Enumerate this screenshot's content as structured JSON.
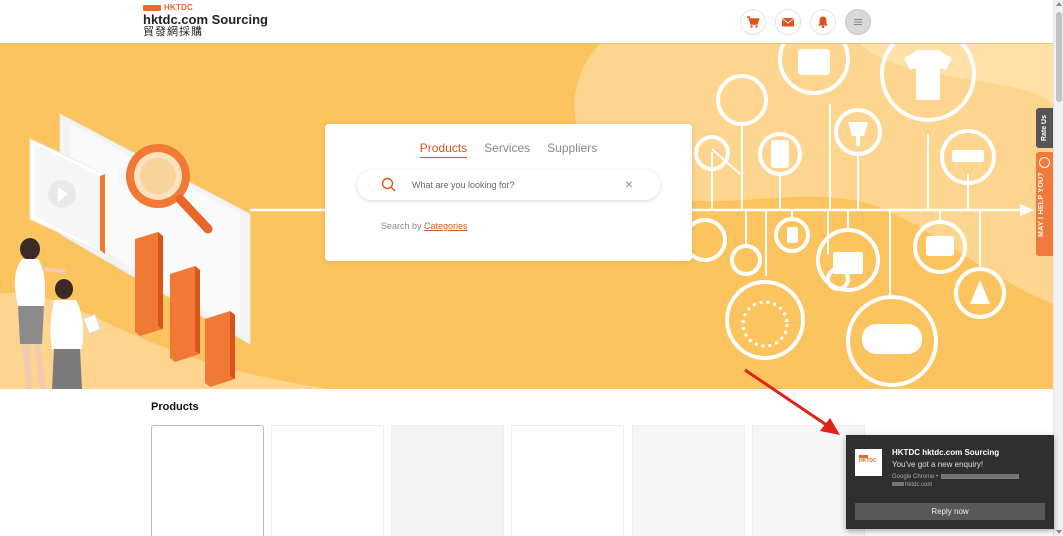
{
  "header": {
    "logo_small": "HKTDC",
    "logo_name": "hktdc.com Sourcing",
    "logo_chinese": "貿發網採購",
    "icons": [
      "cart-icon",
      "mail-icon",
      "bell-icon",
      "menu-icon"
    ]
  },
  "search": {
    "tabs": [
      {
        "label": "Products",
        "active": true
      },
      {
        "label": "Services",
        "active": false
      },
      {
        "label": "Suppliers",
        "active": false
      }
    ],
    "placeholder": "What are you looking for?",
    "clear_symbol": "×",
    "by_prefix": "Search by ",
    "by_link": "Categories"
  },
  "side": {
    "rate_us": "Rate Us",
    "help": "MAY I HELP YOU?"
  },
  "products": {
    "title": "Products"
  },
  "notification": {
    "title": "HKTDC hktdc.com Sourcing",
    "message": "You've got a new enquiry!",
    "source": "Google Chrome •",
    "domain": "hktdc.com",
    "button": "Reply now"
  },
  "colors": {
    "brand_orange": "#e0531d",
    "banner_yellow": "#fcc45f",
    "notification_bg": "#2f2f2f"
  }
}
